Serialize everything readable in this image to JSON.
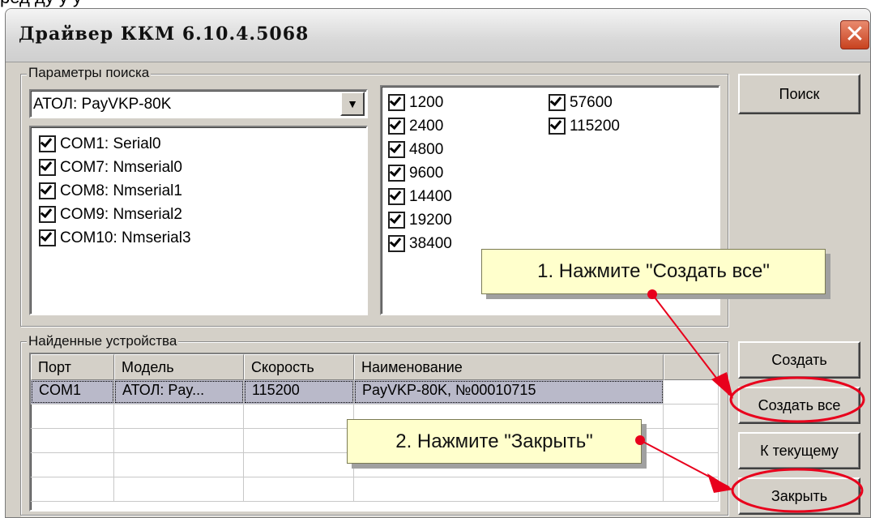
{
  "top_text": "ред   ду     у у",
  "window": {
    "title": "Драйвер ККМ 6.10.4.5068",
    "close_icon": "close-icon"
  },
  "search_params": {
    "legend": "Параметры поиска",
    "model_combo": {
      "value": "АТОЛ: PayVKP-80K"
    },
    "ports": [
      {
        "label": "COM1: Serial0",
        "checked": true
      },
      {
        "label": "COM7: Nmserial0",
        "checked": true
      },
      {
        "label": "COM8: Nmserial1",
        "checked": true
      },
      {
        "label": "COM9: Nmserial2",
        "checked": true
      },
      {
        "label": "COM10: Nmserial3",
        "checked": true
      }
    ],
    "baud_col1": [
      {
        "label": "1200",
        "checked": true
      },
      {
        "label": "2400",
        "checked": true
      },
      {
        "label": "4800",
        "checked": true
      },
      {
        "label": "9600",
        "checked": true
      },
      {
        "label": "14400",
        "checked": true
      },
      {
        "label": "19200",
        "checked": true
      },
      {
        "label": "38400",
        "checked": true
      }
    ],
    "baud_col2": [
      {
        "label": "57600",
        "checked": true
      },
      {
        "label": "115200",
        "checked": true
      }
    ]
  },
  "buttons": {
    "search": "Поиск",
    "create": "Создать",
    "create_all": "Создать все",
    "to_current": "К текущему",
    "close": "Закрыть"
  },
  "found_devices": {
    "legend": "Найденные устройства",
    "columns": [
      "Порт",
      "Модель",
      "Скорость",
      "Наименование"
    ],
    "rows": [
      [
        "COM1",
        "АТОЛ: Pay...",
        "115200",
        "PayVKP-80K, №00010715"
      ]
    ]
  },
  "callouts": {
    "step1": "1. Нажмите \"Создать все\"",
    "step2": "2. Нажмите \"Закрыть\""
  },
  "colors": {
    "annotation_red": "#e8001c",
    "callout_bg": "#ffffcc",
    "selected_row": "#b9b9c9"
  }
}
